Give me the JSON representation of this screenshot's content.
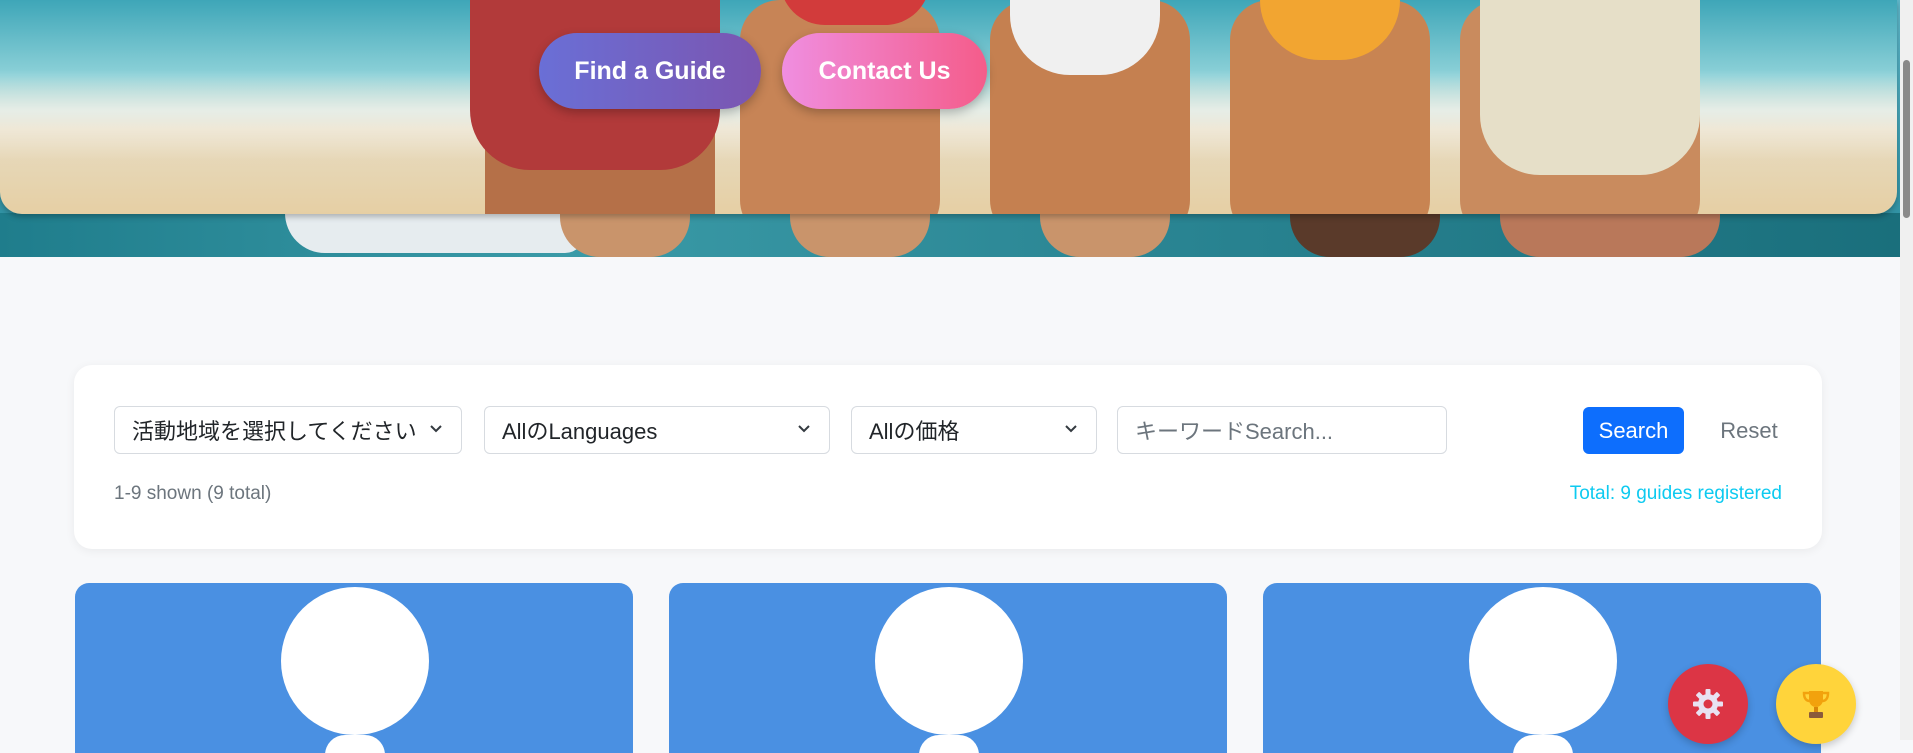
{
  "hero": {
    "find_guide_label": "Find a Guide",
    "contact_label": "Contact Us"
  },
  "filters": {
    "region_selected": "活動地域を選択してください",
    "language_selected": "AllのLanguages",
    "price_selected": "Allの価格",
    "search_placeholder": "キーワードSearch...",
    "search_label": "Search",
    "reset_label": "Reset",
    "shown_text": "1-9 shown (9 total)",
    "total_text": "Total: 9 guides registered"
  },
  "floating": {
    "settings_icon": "gear-icon",
    "trophy_icon": "trophy-icon"
  },
  "colors": {
    "primary": "#0d6efd",
    "info": "#0dcaf0",
    "card_blue": "#4a90e2",
    "danger": "#dc3545",
    "warning": "#ffd43b"
  }
}
